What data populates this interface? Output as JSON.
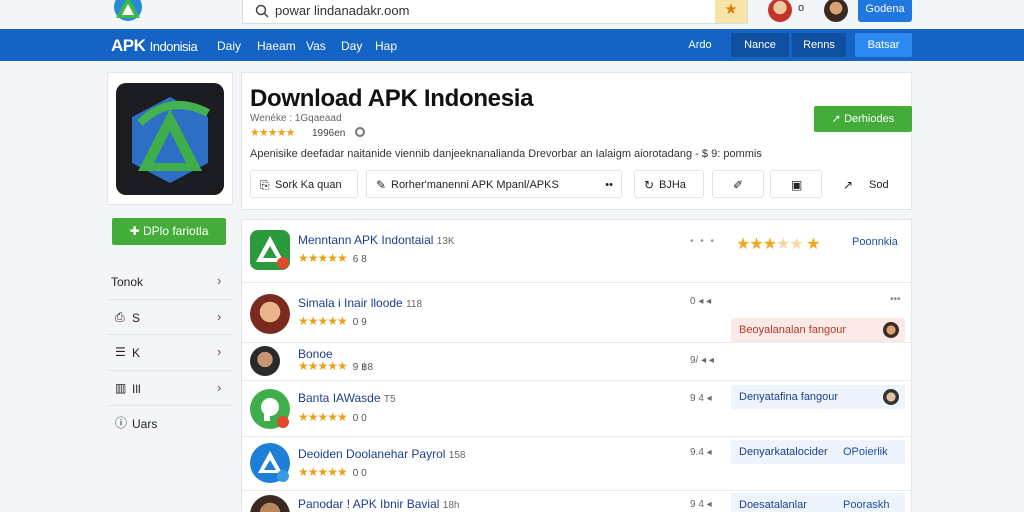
{
  "topbar": {
    "search_text": "powar lindanadakr.oom",
    "mid_text": "o",
    "button": "Godena"
  },
  "nav": {
    "brand": "APK",
    "brand_sub": "Indonisia",
    "items": [
      "Daiy",
      "Haeam",
      "Vas",
      "Day",
      "Hap"
    ],
    "right_items": [
      "Ardo",
      "Nance",
      "Renns",
      "Batsar"
    ]
  },
  "left": {
    "download_label": "DPlo fariotla",
    "menu": [
      {
        "label": "Tonok",
        "icon": ""
      },
      {
        "label": "S",
        "icon": "share-icon"
      },
      {
        "label": "K",
        "icon": "list-icon"
      },
      {
        "label": "Ill",
        "icon": "chart-icon"
      },
      {
        "label": "Uars",
        "icon": "info-icon"
      }
    ]
  },
  "header": {
    "title": "Download APK Indonesia",
    "subtitle": "Wenéke : 1Gqaeaad",
    "stars": "★★★★★",
    "count": "1996en",
    "description": "Apenisike deefadar naitanide viennib danjeeknanalianda Drevorbar an Ialaigm aiorotadang - $ 9: pommis",
    "download_button": "Derhiodes",
    "actions": [
      {
        "label": "Sork Ka quan",
        "icon": "bookmark-icon"
      },
      {
        "label": "Rorher'manenni APK Mpanl/APKS",
        "icon": "edit-icon",
        "right": "••"
      },
      {
        "label": "BJHa",
        "icon": "refresh-icon"
      },
      {
        "label": "",
        "icon": "pin-icon"
      },
      {
        "label": "",
        "icon": "square-icon"
      },
      {
        "label": "Sod",
        "icon": "arrow-icon"
      }
    ]
  },
  "list": {
    "top": {
      "name": "Menntann APK Indontaial",
      "meta": "13K",
      "stars": "★★★★★",
      "rating_num": "6 8",
      "dots": "• • •",
      "rating_label": "Poonnkia"
    },
    "rows": [
      {
        "name": "Simala i Inair lloode",
        "meta": "118",
        "stars": "★★★★★",
        "num": "0 9",
        "mid": "0 ◂ ◂",
        "tag": "Beoyalanalan fangour",
        "tag_bg": "#fbe9e7",
        "tag_color": "#b33a2a"
      },
      {
        "name": "Bonoe",
        "meta": "",
        "stars": "★★★★★",
        "num": "9 ฿8",
        "mid": "9/ ◂ ◂",
        "tag": "",
        "tag_bg": "",
        "tag_color": ""
      },
      {
        "name": "Banta IAWasde",
        "meta": "T5",
        "stars": "★★★★★",
        "num": "0 0",
        "mid": "9 4 ◂",
        "tag": "Denyatafina fangour",
        "tag_bg": "#eef4fb",
        "tag_color": "#1b3f8f"
      },
      {
        "name": "Deoiden Doolanehar Payrol",
        "meta": "158",
        "stars": "★★★★★",
        "num": "0 0",
        "mid": "9.4 ◂",
        "tag": "Denyarkatalocider",
        "tag_extra": "OPoierlik",
        "tag_bg": "#eef4fb",
        "tag_color": "#1b3f8f"
      },
      {
        "name": "Panodar ! APK Ibnir Bavial",
        "meta": "18h",
        "stars": "",
        "num": "",
        "mid": "9 4 ◂",
        "tag": "Doesatalanlar",
        "tag_extra": "Pooraskh",
        "tag_bg": "#eef4fb",
        "tag_color": "#1b3f8f"
      }
    ]
  },
  "colors": {
    "nav_blue": "#1463c5",
    "green": "#44ad3a",
    "star": "#e9a21b"
  }
}
